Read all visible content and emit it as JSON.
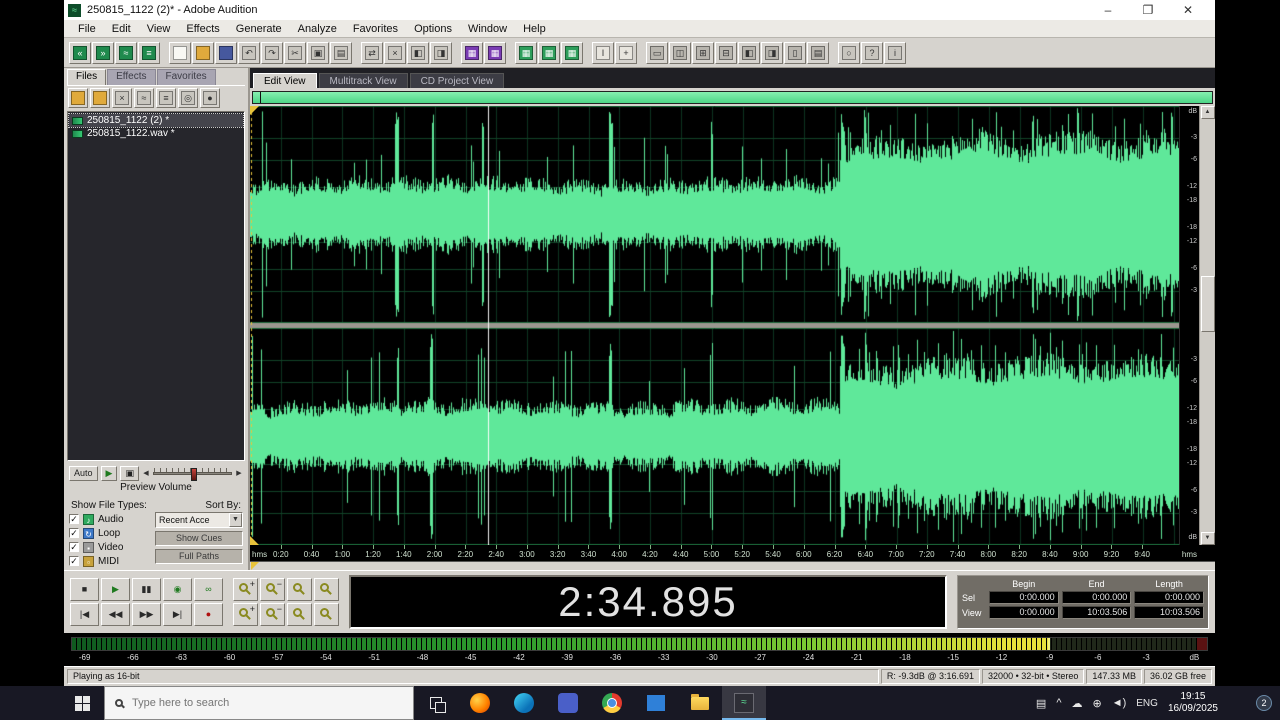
{
  "colors": {
    "wave_green": "#5fe89a",
    "grid_green": "#124528",
    "panel_gray": "#d6d3ce",
    "marker_yellow": "#e8c33c"
  },
  "window": {
    "title": "250815_1122 (2)* - Adobe Audition",
    "icon_glyph": "≈",
    "minimize": "–",
    "maximize": "❐",
    "close": "✕"
  },
  "menu": {
    "items": [
      "File",
      "Edit",
      "View",
      "Effects",
      "Generate",
      "Analyze",
      "Favorites",
      "Options",
      "Window",
      "Help"
    ]
  },
  "toolbar": {
    "icons": [
      {
        "n": "edit-view-icon",
        "c": "#1f8a4d",
        "g": "«"
      },
      {
        "n": "multitrack-view-icon",
        "c": "#1f8a4d",
        "g": "»"
      },
      {
        "n": "spectral-view-icon",
        "c": "#1f8a4d",
        "g": "≈"
      },
      {
        "n": "cd-view-icon",
        "c": "#1f8a4d",
        "g": "≡"
      },
      {
        "n": "sep"
      },
      {
        "n": "new-file-icon",
        "c": "#f8f8f4",
        "g": ""
      },
      {
        "n": "open-file-icon",
        "c": "#e0aa3c",
        "g": ""
      },
      {
        "n": "save-file-icon",
        "c": "#46589e",
        "g": ""
      },
      {
        "n": "undo-icon",
        "c": "#c8c5be",
        "g": "↶"
      },
      {
        "n": "redo-icon",
        "c": "#c8c5be",
        "g": "↷"
      },
      {
        "n": "cut-icon",
        "c": "#c8c5be",
        "g": "✂"
      },
      {
        "n": "copy-icon",
        "c": "#c8c5be",
        "g": "▣"
      },
      {
        "n": "paste-icon",
        "c": "#c8c5be",
        "g": "▤"
      },
      {
        "n": "sep"
      },
      {
        "n": "mix-paste-icon",
        "c": "#c8c5be",
        "g": "⇄"
      },
      {
        "n": "delete-icon",
        "c": "#c8c5be",
        "g": "×"
      },
      {
        "n": "trim-icon",
        "c": "#c8c5be",
        "g": "◧"
      },
      {
        "n": "convert-sample-type-icon",
        "c": "#c8c5be",
        "g": "◨"
      },
      {
        "n": "sep"
      },
      {
        "n": "frequency-analysis-icon",
        "c": "#7a3cb3",
        "g": "▦"
      },
      {
        "n": "phase-analysis-icon",
        "c": "#7a3cb3",
        "g": "▦"
      },
      {
        "n": "sep"
      },
      {
        "n": "waveform-group-icon",
        "c": "#2e9e5b",
        "g": "▦"
      },
      {
        "n": "spectral-group-icon",
        "c": "#2e9e5b",
        "g": "▦"
      },
      {
        "n": "mixer-group-icon",
        "c": "#2e9e5b",
        "g": "▦"
      },
      {
        "n": "sep"
      },
      {
        "n": "ibeam-tool-icon",
        "c": "#e8e5de",
        "g": "I"
      },
      {
        "n": "scrub-tool-icon",
        "c": "#e8e5de",
        "g": "+"
      },
      {
        "n": "sep"
      },
      {
        "n": "workspace-1-icon",
        "c": "#b8b5ae",
        "g": "▭"
      },
      {
        "n": "workspace-2-icon",
        "c": "#b8b5ae",
        "g": "◫"
      },
      {
        "n": "workspace-3-icon",
        "c": "#b8b5ae",
        "g": "⊞"
      },
      {
        "n": "workspace-4-icon",
        "c": "#b8b5ae",
        "g": "⊟"
      },
      {
        "n": "workspace-5-icon",
        "c": "#b8b5ae",
        "g": "◧"
      },
      {
        "n": "workspace-6-icon",
        "c": "#b8b5ae",
        "g": "◨"
      },
      {
        "n": "workspace-7-icon",
        "c": "#b8b5ae",
        "g": "▯"
      },
      {
        "n": "workspace-8-icon",
        "c": "#b8b5ae",
        "g": "▤"
      },
      {
        "n": "sep"
      },
      {
        "n": "cue-list-icon",
        "c": "#c8c5be",
        "g": "○"
      },
      {
        "n": "help-icon",
        "c": "#c8c5be",
        "g": "?"
      },
      {
        "n": "about-icon",
        "c": "#c8c5be",
        "g": "i"
      }
    ]
  },
  "left_panel": {
    "tabs": [
      "Files",
      "Effects",
      "Favorites"
    ],
    "file_toolbar": [
      {
        "n": "import-file-icon",
        "c": "#e0aa3c",
        "g": ""
      },
      {
        "n": "open-folder-icon",
        "c": "#e0aa3c",
        "g": ""
      },
      {
        "n": "close-file-icon",
        "c": "#c8c5be",
        "g": "×"
      },
      {
        "n": "edit-file-icon",
        "c": "#c8c5be",
        "g": "≈"
      },
      {
        "n": "insert-multitrack-icon",
        "c": "#c8c5be",
        "g": "≡"
      },
      {
        "n": "insert-cd-icon",
        "c": "#c8c5be",
        "g": "◎"
      },
      {
        "n": "file-options-icon",
        "c": "#c8c5be",
        "g": "●"
      }
    ],
    "files": [
      {
        "name": "250815_1122 (2) *",
        "selected": true
      },
      {
        "name": "250815_1122.wav *",
        "selected": false
      }
    ],
    "auto": "Auto",
    "play_glyph": "▶",
    "loop_glyph": "▣",
    "arrow_left": "◀",
    "arrow_right": "▶",
    "preview_volume": "Preview Volume",
    "show_file_types": "Show File Types:",
    "sort_by": "Sort By:",
    "types": [
      {
        "label": "Audio",
        "color": "#2faa5f",
        "glyph": "♪"
      },
      {
        "label": "Loop",
        "color": "#3c78c8",
        "glyph": "↻"
      },
      {
        "label": "Video",
        "color": "#9a9a9a",
        "glyph": "▪"
      },
      {
        "label": "MIDI",
        "color": "#c8a23c",
        "glyph": "▫"
      }
    ],
    "check_glyph": "✓",
    "sort_value": "Recent Acce",
    "dropdown_glyph": "▼",
    "show_cues": "Show Cues",
    "full_paths": "Full Paths"
  },
  "views": {
    "tabs": [
      "Edit View",
      "Multitrack View",
      "CD Project View"
    ],
    "active": 0
  },
  "wave": {
    "duration_s": 603.506,
    "playhead_s": 154.895,
    "loud_start_s": 383,
    "db_labels": [
      -3,
      -6,
      -12,
      -18
    ],
    "ruler_unit": "dB"
  },
  "timeline": {
    "unit": "hms",
    "ticks": [
      "0:20",
      "0:40",
      "1:00",
      "1:20",
      "1:40",
      "2:00",
      "2:20",
      "2:40",
      "3:00",
      "3:20",
      "3:40",
      "4:00",
      "4:20",
      "4:40",
      "5:00",
      "5:20",
      "5:40",
      "6:00",
      "6:20",
      "6:40",
      "7:00",
      "7:20",
      "7:40",
      "8:00",
      "8:20",
      "8:40",
      "9:00",
      "9:20",
      "9:40"
    ]
  },
  "transport": {
    "row1": [
      {
        "name": "stop-button",
        "glyph": "■",
        "color": "#2a2a2a"
      },
      {
        "name": "play-button",
        "glyph": "▶",
        "color": "#1f7a1f"
      },
      {
        "name": "pause-button",
        "glyph": "▮▮",
        "color": "#2a2a2a"
      },
      {
        "name": "play-looped-button",
        "glyph": "◉",
        "color": "#1f7a1f"
      },
      {
        "name": "play-to-end-button",
        "glyph": "∞",
        "color": "#1f7a1f"
      }
    ],
    "row2": [
      {
        "name": "go-to-beginning-button",
        "glyph": "|◀",
        "color": "#2a2a2a"
      },
      {
        "name": "rewind-button",
        "glyph": "◀◀",
        "color": "#2a2a2a"
      },
      {
        "name": "fast-forward-button",
        "glyph": "▶▶",
        "color": "#2a2a2a"
      },
      {
        "name": "go-to-end-button",
        "glyph": "▶|",
        "color": "#2a2a2a"
      },
      {
        "name": "record-button",
        "glyph": "●",
        "color": "#b01010"
      }
    ]
  },
  "zoom": {
    "row1": [
      {
        "name": "zoom-in-horizontal-button",
        "sign": "+"
      },
      {
        "name": "zoom-out-horizontal-button",
        "sign": "−"
      },
      {
        "name": "zoom-to-selection-button",
        "sign": ""
      },
      {
        "name": "zoom-full-button",
        "sign": ""
      }
    ],
    "row2": [
      {
        "name": "zoom-in-vertical-button",
        "sign": "+"
      },
      {
        "name": "zoom-out-vertical-button",
        "sign": "−"
      },
      {
        "name": "zoom-left-edge-button",
        "sign": ""
      },
      {
        "name": "zoom-right-edge-button",
        "sign": ""
      }
    ]
  },
  "time_display": "2:34.895",
  "selection": {
    "headers": [
      "Begin",
      "End",
      "Length"
    ],
    "rows": [
      {
        "label": "Sel",
        "values": [
          "0:00.000",
          "0:00.000",
          "0:00.000"
        ]
      },
      {
        "label": "View",
        "values": [
          "0:00.000",
          "10:03.506",
          "10:03.506"
        ]
      }
    ]
  },
  "meter": {
    "labels": [
      "-69",
      "-66",
      "-63",
      "-60",
      "-57",
      "-54",
      "-51",
      "-48",
      "-45",
      "-42",
      "-39",
      "-36",
      "-33",
      "-30",
      "-27",
      "-24",
      "-21",
      "-18",
      "-15",
      "-12",
      "-9",
      "-6",
      "-3",
      "dB"
    ],
    "level_fraction": 0.86
  },
  "status": {
    "playing": "Playing as 16-bit",
    "record": "R: -9.3dB @  3:16.691",
    "format": "32000 • 32-bit • Stereo",
    "size": "147.33 MB",
    "free": "36.02 GB free"
  },
  "taskbar": {
    "search_placeholder": "Type here to search",
    "apps": [
      {
        "name": "task-view",
        "glyph": ""
      },
      {
        "name": "firefox",
        "glyph": ""
      },
      {
        "name": "edge",
        "glyph": ""
      },
      {
        "name": "teams",
        "glyph": ""
      },
      {
        "name": "chrome",
        "glyph": ""
      },
      {
        "name": "store",
        "glyph": ""
      },
      {
        "name": "explorer",
        "glyph": ""
      },
      {
        "name": "audition",
        "glyph": "≈",
        "active": true
      }
    ],
    "tray": [
      {
        "name": "touch-keyboard-icon",
        "glyph": "▤"
      },
      {
        "name": "hidden-icons-chevron",
        "glyph": "^"
      },
      {
        "name": "cloud-icon",
        "glyph": "☁"
      },
      {
        "name": "network-icon",
        "glyph": "⊕"
      },
      {
        "name": "volume-icon",
        "glyph": "◄)"
      }
    ],
    "lang": "ENG",
    "time": "19:15",
    "date": "16/09/2025",
    "badge": "2"
  }
}
